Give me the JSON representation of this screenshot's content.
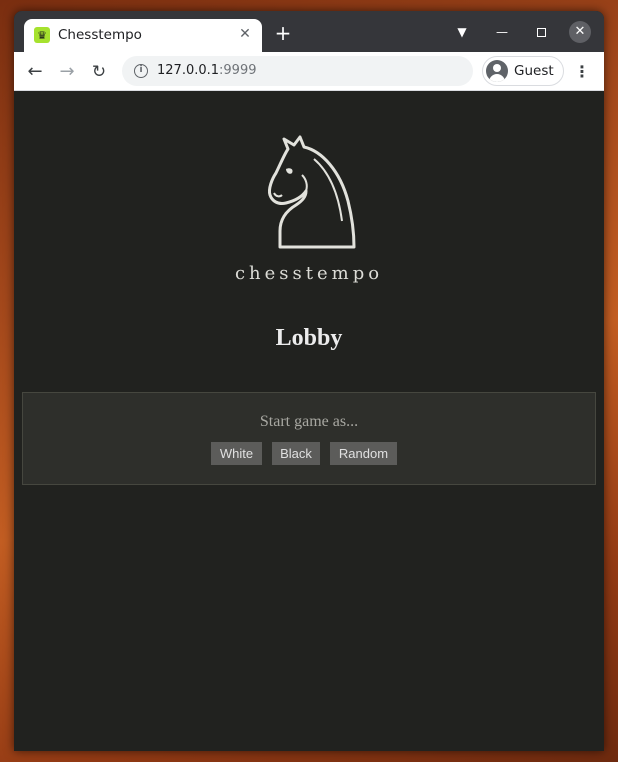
{
  "browser": {
    "tab_title": "Chesstempo",
    "favicon": "chess-queen-icon",
    "url_host": "127.0.0.1",
    "url_port": ":9999",
    "profile_label": "Guest"
  },
  "page": {
    "brand": "chesstempo",
    "title": "Lobby",
    "panel": {
      "prompt": "Start game as...",
      "buttons": {
        "white": "White",
        "black": "Black",
        "random": "Random"
      }
    }
  },
  "colors": {
    "page_background": "#21221f",
    "panel_background": "#2e2f2b",
    "button_background": "#5c5c5a",
    "favicon_accent": "#a6e22e"
  }
}
